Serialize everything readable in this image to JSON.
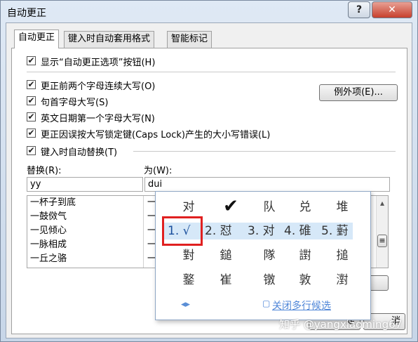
{
  "window": {
    "title": "自动更正",
    "help_label": "?",
    "close_label": "✕"
  },
  "tabs": [
    {
      "label": "自动更正"
    },
    {
      "label": "键入时自动套用格式"
    },
    {
      "label": "智能标记"
    }
  ],
  "options": {
    "show_button": "显示“自动更正选项”按钮(H)",
    "two_caps": "更正前两个字母连续大写(O)",
    "sentence_cap": "句首字母大写(S)",
    "english_date": "英文日期第一个字母大写(N)",
    "caps_lock": "更正因误按大写锁定键(Caps Lock)产生的大小写错误(L)",
    "exceptions_button": "例外项(E)...",
    "replace_as_type": "键入时自动替换(T)"
  },
  "replace": {
    "replace_label": "替换(R):",
    "with_label": "为(W):",
    "replace_value": "yy",
    "with_value": "dui",
    "rows": [
      {
        "name": "一杯子到底"
      },
      {
        "name": "一鼓傚气"
      },
      {
        "name": "一见倾心"
      },
      {
        "name": "一脉相成"
      },
      {
        "name": "一丘之骆"
      }
    ],
    "row_values": [
      "一",
      "一",
      "一",
      "一",
      "一"
    ],
    "scroll_up": "▴",
    "scroll_grip": "≡"
  },
  "ime": {
    "row1": [
      "对",
      "✔",
      "队",
      "兑",
      "堆"
    ],
    "candidates": [
      {
        "label": "1. √"
      },
      {
        "label": "2. 怼"
      },
      {
        "label": "3. 对"
      },
      {
        "label": "4. 碓"
      },
      {
        "label": "5. 薱"
      }
    ],
    "row3": [
      "對",
      "鎚",
      "隊",
      "譵",
      "搥"
    ],
    "row4": [
      "鐜",
      "崔",
      "镦",
      "敦",
      "濧"
    ],
    "nav": "◂▸",
    "close_link": "关闭多行候选",
    "close_icon": "▢"
  },
  "bottom": {
    "ok_partial": "定",
    "cancel_partial": "消"
  },
  "watermark": "知乎 @yangxiaoming67"
}
